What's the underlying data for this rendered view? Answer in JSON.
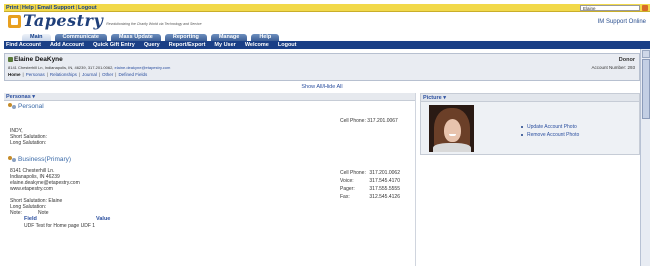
{
  "utility": {
    "print": "Print",
    "help": "Help",
    "email_support": "Email Support",
    "logout": "Logout",
    "search_value": "Elaine"
  },
  "header": {
    "logo": "Tapestry",
    "tagline": "Revolutionizing the Charity World via Technology and Service",
    "support": "IM Support Online"
  },
  "tabs": [
    "Main",
    "Communicate",
    "Mass Update",
    "Reporting",
    "Manage",
    "Help"
  ],
  "nav": [
    "Find Account",
    "Add Account",
    "Quick Gift Entry",
    "Query",
    "Report/Export",
    "My User",
    "Welcome",
    "Logout"
  ],
  "donor": {
    "name": "Elaine DeaKyne",
    "address": "8141 Chesterhill Ln, Indianapolis, IN, 46239, 317.201.0062,",
    "email": "elaine.deakyne@etapestry.com",
    "type": "Donor",
    "account_number": "Account Number: 293",
    "links": [
      "Home",
      "Personas",
      "Relationships",
      "Journal",
      "Other",
      "Defined Fields"
    ]
  },
  "show_all_hide_all": "Show All/Hide All",
  "personas": {
    "header": "Personas",
    "personal": {
      "title": "Personal",
      "city": "INDY,",
      "short_salutation": "Short Salutation:",
      "long_salutation": "Long Salutation:",
      "cell_phone": "Cell Phone: 317.201.0067"
    },
    "business": {
      "title": "Business(Primary)",
      "address1": "8141 Chesterhill Ln.",
      "address2": "Indianapolis, IN 46239",
      "email": "elaine.deakyne@etapestry.com",
      "web": "www.etapestry.com",
      "short_salutation": "Short Salutation: Elaine",
      "long_salutation": "Long Salutation:",
      "note_label": "Note:",
      "note_value": "Note",
      "phones": [
        {
          "label": "Cell Phone:",
          "value": "317.201.0062"
        },
        {
          "label": "Voice:",
          "value": "317.545.4170"
        },
        {
          "label": "Pager:",
          "value": "317.555.5555"
        },
        {
          "label": "Fax:",
          "value": "312.545.4126"
        }
      ],
      "field_header": "Field",
      "value_header": "Value",
      "udf_row": "UDF Test for Home page UDF 1"
    }
  },
  "picture": {
    "header": "Picture",
    "update": "Update Account Photo",
    "remove": "Remove Account Photo"
  }
}
